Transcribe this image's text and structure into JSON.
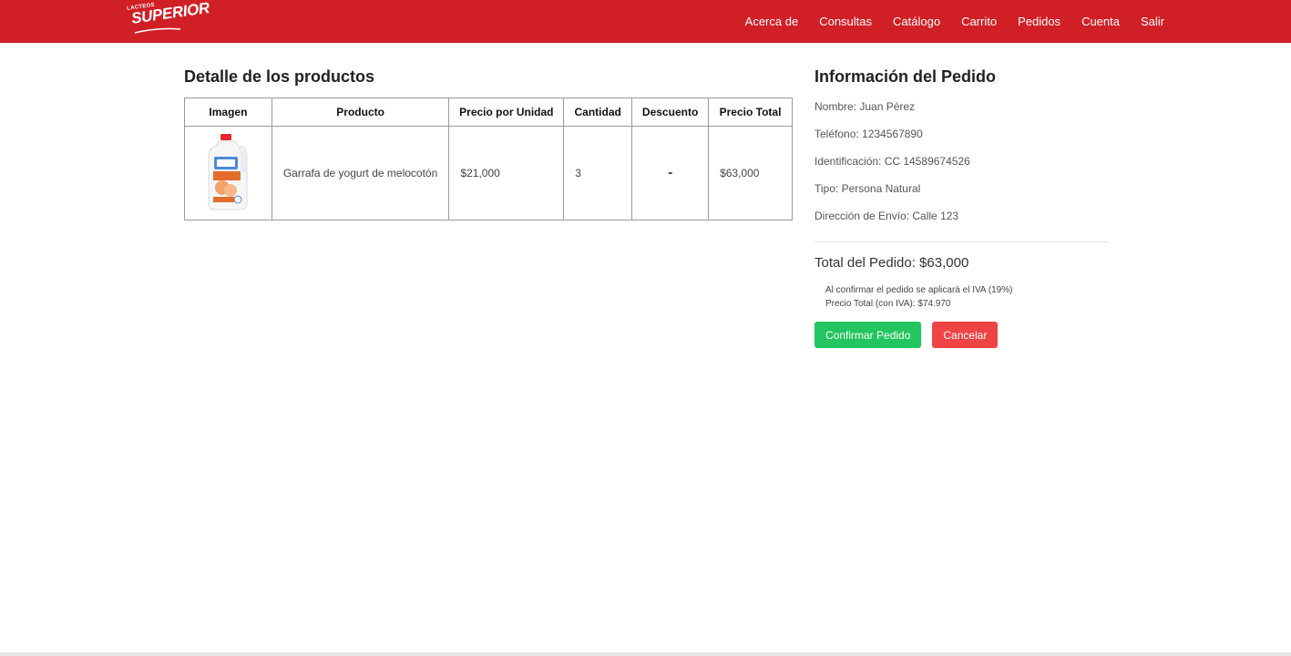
{
  "brand": {
    "logo_small": "LACTEOS",
    "logo_main": "SUPERIOR",
    "color": "#d11f26"
  },
  "nav": {
    "items": [
      {
        "label": "Acerca de"
      },
      {
        "label": "Consultas"
      },
      {
        "label": "Catálogo"
      },
      {
        "label": "Carrito"
      },
      {
        "label": "Pedidos"
      },
      {
        "label": "Cuenta"
      },
      {
        "label": "Salir"
      }
    ]
  },
  "products": {
    "title": "Detalle de los productos",
    "columns": [
      "Imagen",
      "Producto",
      "Precio por Unidad",
      "Cantidad",
      "Descuento",
      "Precio Total"
    ],
    "rows": [
      {
        "image_icon": "yogurt-jug-icon",
        "product": "Garrafa de yogurt de melocotón",
        "unit_price": "$21,000",
        "quantity": "3",
        "discount": "-",
        "total": "$63,000"
      }
    ]
  },
  "order": {
    "title": "Información del Pedido",
    "name": "Nombre: Juan Pérez",
    "phone": "Teléfono: 1234567890",
    "id": "Identificación: CC 14589674526",
    "type": "Tipo: Persona Natural",
    "address": "Dirección de Envío: Calle 123",
    "total": "Total del Pedido: $63,000",
    "iva_note": "Al confirmar el pedido se aplicará el IVA (19%)",
    "iva_total": "Precio Total (con IVA): $74.970",
    "confirm_label": "Confirmar Pedido",
    "cancel_label": "Cancelar",
    "confirm_color": "#22c55e",
    "cancel_color": "#ef4444"
  }
}
